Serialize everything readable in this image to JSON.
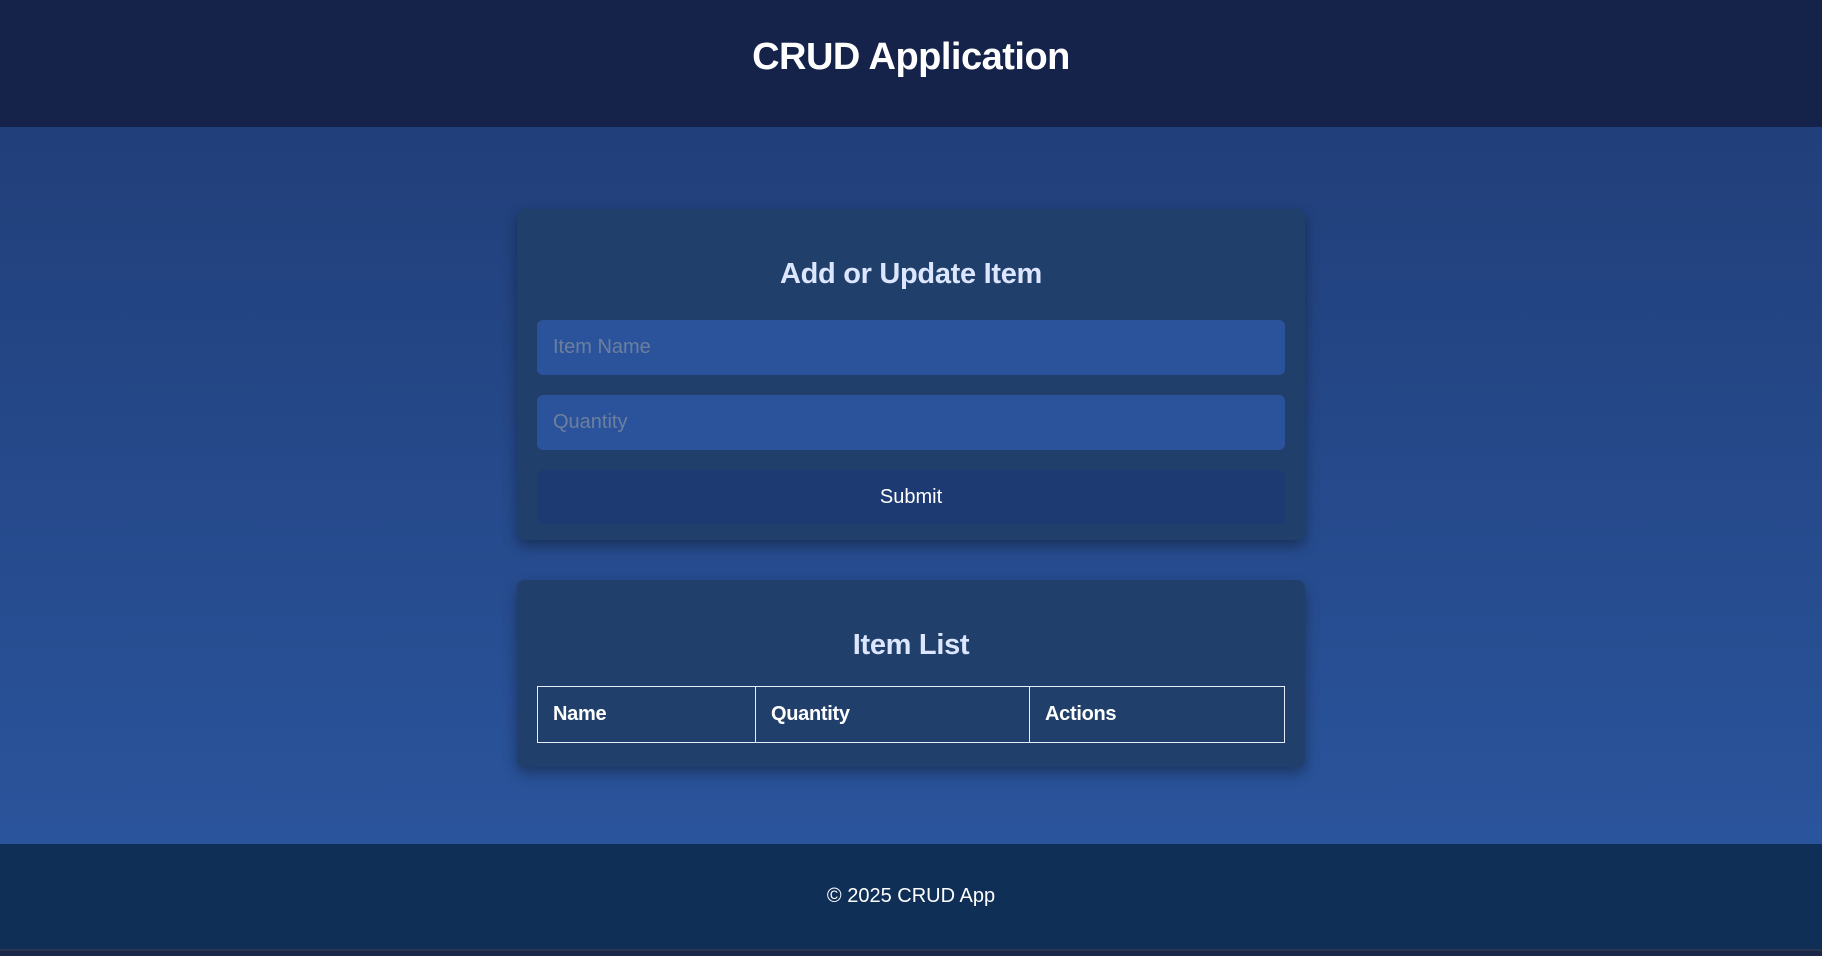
{
  "header": {
    "title": "CRUD Application"
  },
  "form_card": {
    "heading": "Add or Update Item",
    "item_name_placeholder": "Item Name",
    "item_name_value": "",
    "quantity_placeholder": "Quantity",
    "quantity_value": "",
    "submit_label": "Submit"
  },
  "list_card": {
    "heading": "Item List",
    "columns": [
      "Name",
      "Quantity",
      "Actions"
    ],
    "rows": []
  },
  "footer": {
    "text": "© 2025 CRUD App"
  },
  "colors": {
    "header_bg": "#15234a",
    "card_bg": "#203f6b",
    "input_bg": "#2a539b",
    "button_bg": "#1e3a72",
    "footer_bg": "#0f2f57"
  }
}
